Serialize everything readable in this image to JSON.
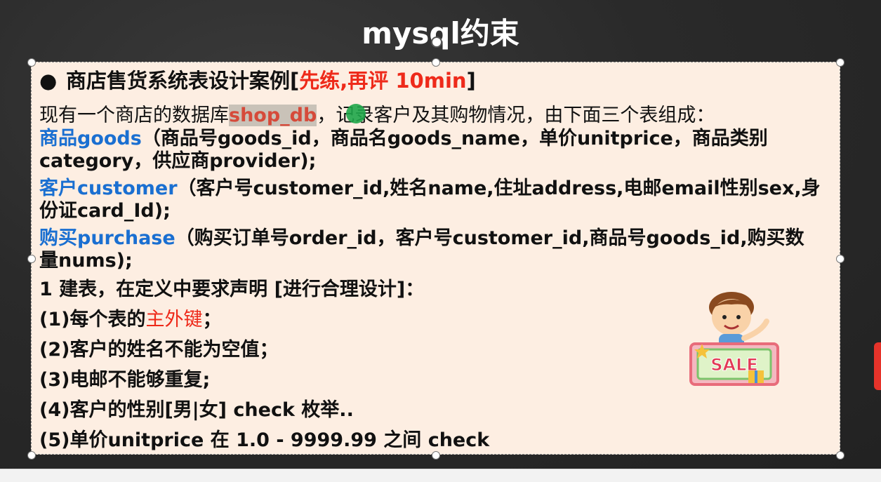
{
  "slide": {
    "title": "mysql约束",
    "heading_prefix": "商店售货系统表设计案例[",
    "heading_red": "先练,再评 10min",
    "heading_suffix": "]",
    "intro_a": "现有一个商店的数据库",
    "intro_db": "shop_db",
    "intro_b": "，记录客户及其购物情况，由下面三个表组成：",
    "goods_label": "商品goods",
    "goods_text_1": "（商品号goods_id，商品名goods_name，单价unitprice，商品类别",
    "goods_text_2": "category，供应商provider);",
    "customer_label": "客户customer",
    "customer_text_1": "（客户号customer_id,姓名name,住址address,电邮email性别sex,身",
    "customer_text_2": "份证card_Id);",
    "purchase_label": "购买purchase",
    "purchase_text_1": "（购买订单号order_id，客户号customer_id,商品号goods_id,购买数",
    "purchase_text_2": "量nums);",
    "req_intro": "1 建表，在定义中要求声明 [进行合理设计]：",
    "req1_a": "(1)每个表的",
    "req1_red": "主外键",
    "req1_b": "；",
    "req2": "(2)客户的姓名不能为空值；",
    "req3": "(3)电邮不能够重复;",
    "req4": "(4)客户的性别[男|女] check 枚举..",
    "req5": "(5)单价unitprice 在 1.0 - 9999.99 之间 check",
    "sale_text": "SALE"
  },
  "colors": {
    "board": "#2b2b2b",
    "box": "#fdeee2",
    "blue": "#1a6fd1",
    "red": "#ee2a1a",
    "cursor": "#1fa64a"
  },
  "icons": {
    "bullet": "bullet-dot",
    "sale": "sale-boy-illustration"
  }
}
